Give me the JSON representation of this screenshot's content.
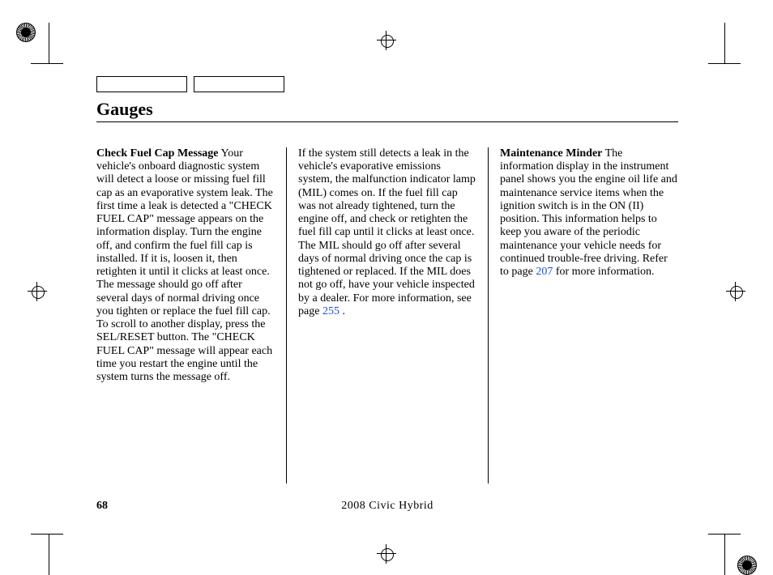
{
  "document": {
    "page_number": "68",
    "footer": "2008  Civic  Hybrid",
    "section_title": "Gauges",
    "columns": [
      {
        "heading": "Check Fuel Cap Message",
        "paragraphs": [
          "Your vehicle's onboard diagnostic system will detect a loose or missing fuel fill cap as an evaporative system leak. The first time a leak is detected a \"CHECK FUEL CAP\" message appears on the information display. Turn the engine off, and confirm the fuel fill cap is installed. If it is, loosen it, then retighten it until it clicks at least once. The message should go off after several days of normal driving once you tighten or replace the fuel fill cap. To scroll to another display, press the SEL/RESET button. The \"CHECK FUEL CAP\" message will appear each time you restart the engine until the system turns the message off."
        ]
      },
      {
        "heading": "",
        "paragraphs": [
          "If the system still detects a leak in the vehicle's evaporative emissions system, the malfunction indicator lamp (MIL) comes on. If the fuel fill cap was not already tightened, turn the engine off, and check or retighten the fuel fill cap until it clicks at least once. The MIL should go off after several days of normal driving once the cap is tightened or replaced. If the MIL does not go off, have your vehicle inspected by a dealer. For more information, see page "
        ],
        "link_text": "255",
        "tail": " ."
      },
      {
        "heading": "Maintenance Minder",
        "paragraphs": [
          "The information display in the instrument panel shows you the engine oil life and maintenance service items when the ignition switch is in the ON (II) position. This information helps to keep you aware of the periodic maintenance your vehicle needs for continued trouble-free driving. Refer to page "
        ],
        "link_text": "207",
        "tail": " for more information."
      }
    ]
  }
}
